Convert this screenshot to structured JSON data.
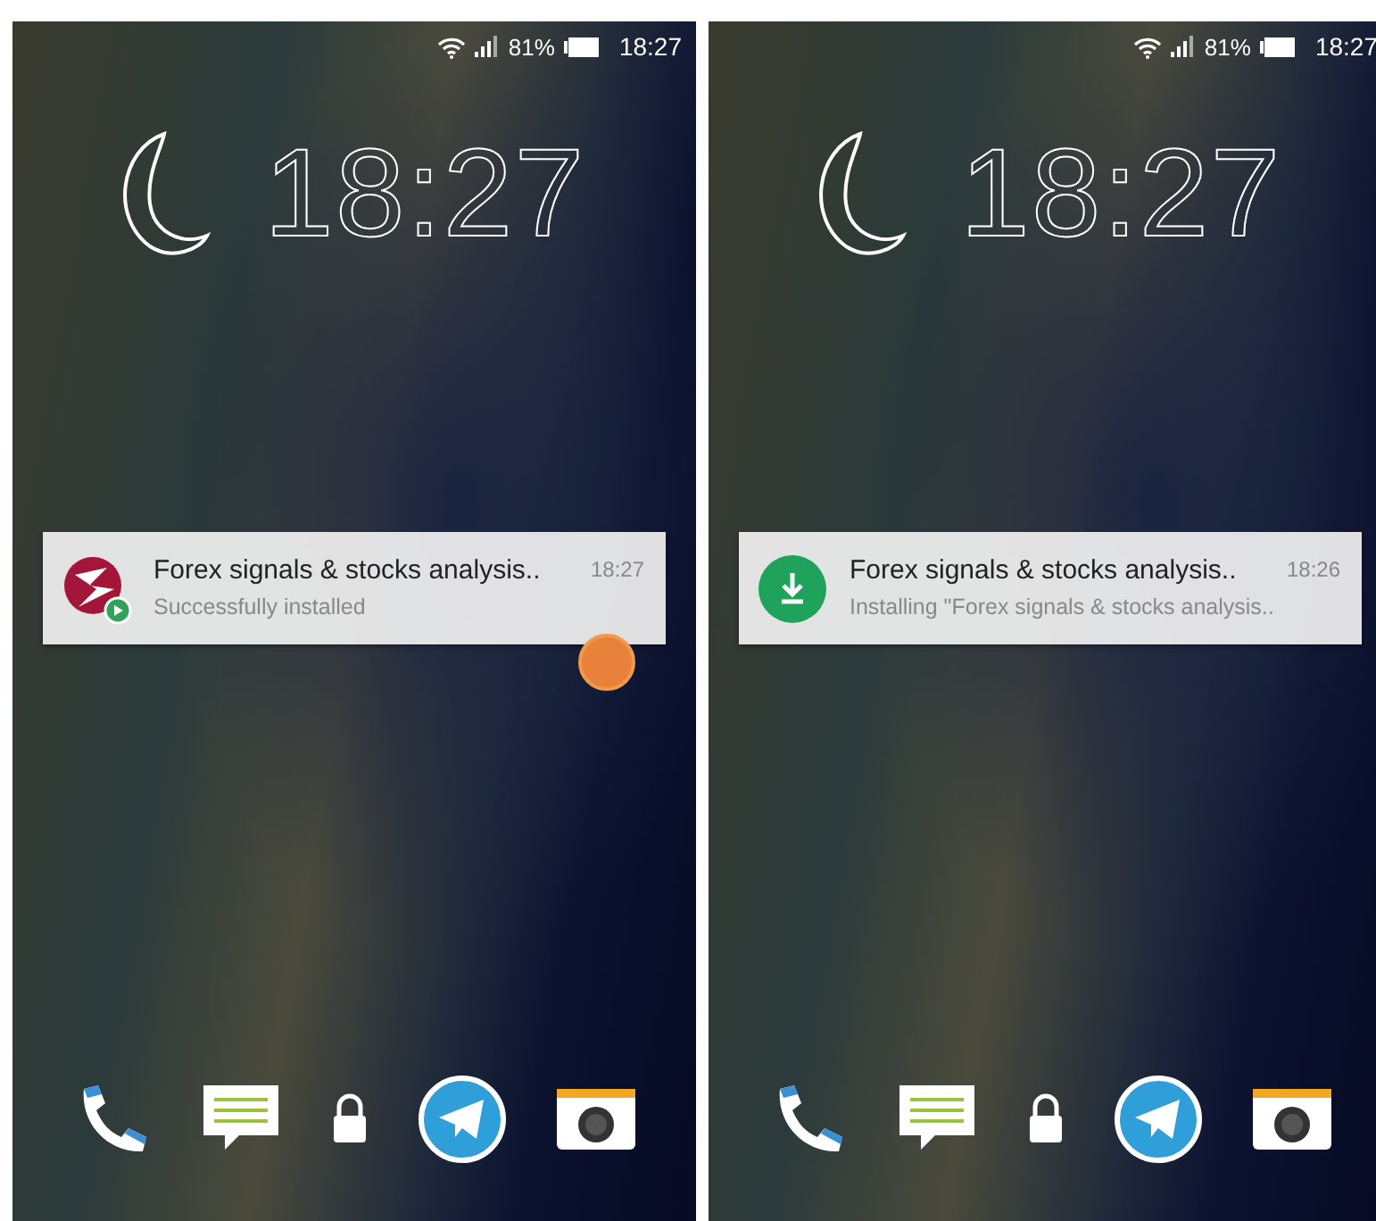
{
  "screens": [
    {
      "status_bar": {
        "battery": "81%",
        "time": "18:27"
      },
      "clock": "18:27",
      "notification": {
        "kind": "app-logo",
        "title": "Forex signals & stocks analysis..",
        "subtitle": "Successfully installed",
        "time": "18:27"
      },
      "touch_indicator": true
    },
    {
      "status_bar": {
        "battery": "81%",
        "time": "18:27"
      },
      "clock": "18:27",
      "notification": {
        "kind": "download",
        "title": "Forex signals & stocks analysis..",
        "subtitle": "Installing \"Forex signals & stocks analysis..",
        "time": "18:26"
      },
      "touch_indicator": false
    }
  ]
}
